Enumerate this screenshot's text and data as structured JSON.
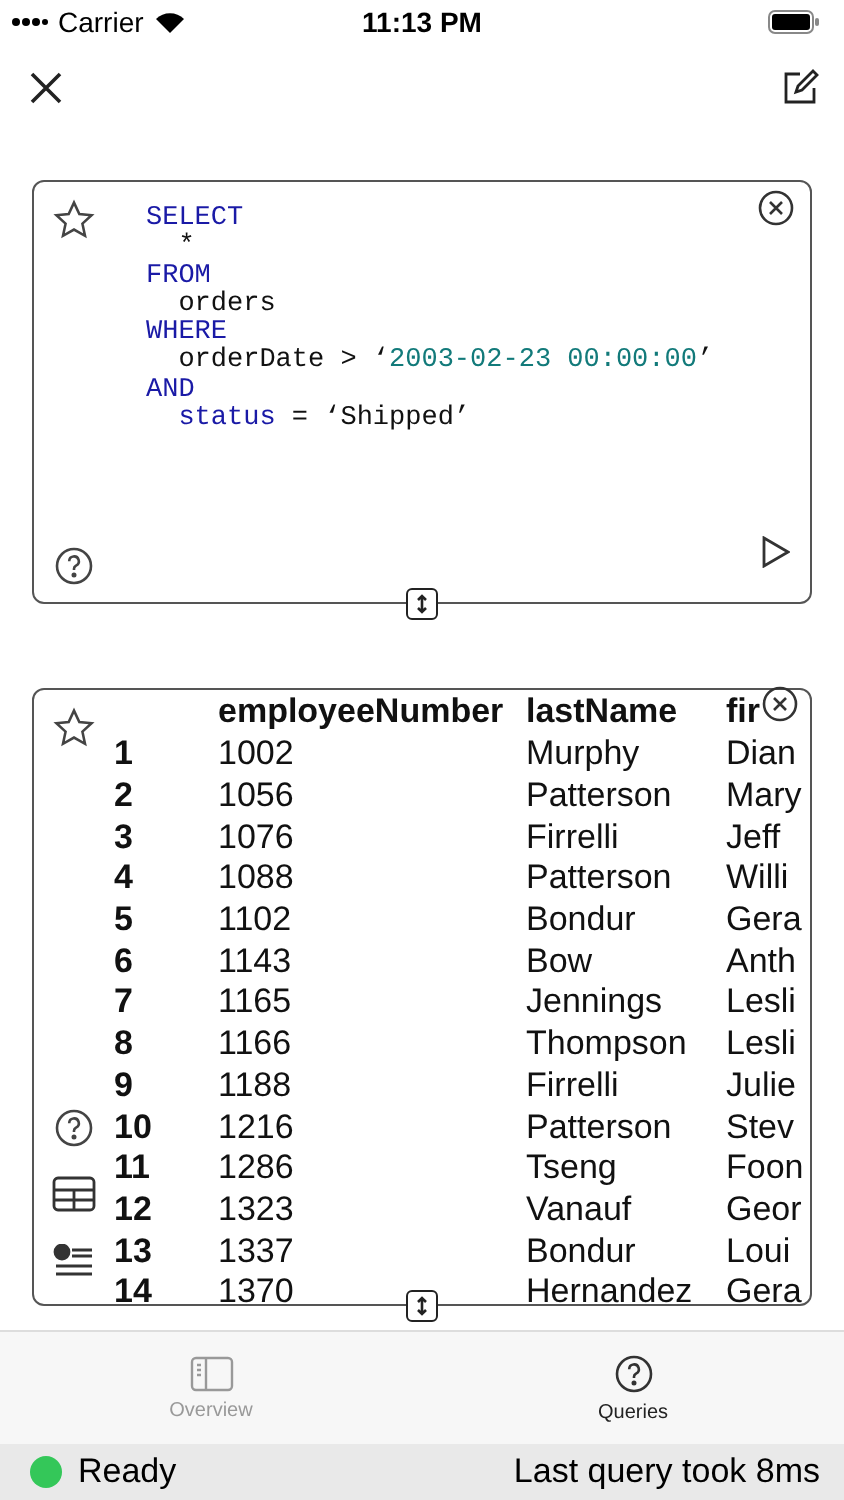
{
  "status_bar": {
    "carrier": "Carrier",
    "time": "11:13 PM"
  },
  "query_card": {
    "lines": [
      [
        {
          "text": "SELECT",
          "kind": "keyword"
        }
      ],
      [
        {
          "text": "  *",
          "kind": "plain"
        }
      ],
      [
        {
          "text": "FROM",
          "kind": "keyword"
        }
      ],
      [
        {
          "text": "  orders",
          "kind": "plain"
        }
      ],
      [
        {
          "text": "WHERE",
          "kind": "keyword"
        }
      ],
      [
        {
          "text": "  orderDate > ‘",
          "kind": "plain"
        },
        {
          "text": "2003-02-23 00:00:00",
          "kind": "literal"
        },
        {
          "text": "’",
          "kind": "plain"
        }
      ],
      [
        {
          "text": "AND",
          "kind": "keyword"
        }
      ],
      [
        {
          "text": "  status",
          "kind": "keyword"
        },
        {
          "text": " = ‘Shipped’",
          "kind": "plain"
        }
      ]
    ]
  },
  "results": {
    "columns": [
      "",
      "employeeNumber",
      "lastName",
      "fir"
    ],
    "rows": [
      [
        "1",
        "1002",
        "Murphy",
        "Dian"
      ],
      [
        "2",
        "1056",
        "Patterson",
        "Mary"
      ],
      [
        "3",
        "1076",
        "Firrelli",
        "Jeff"
      ],
      [
        "4",
        "1088",
        "Patterson",
        "Willi"
      ],
      [
        "5",
        "1102",
        "Bondur",
        "Gera"
      ],
      [
        "6",
        "1143",
        "Bow",
        "Anth"
      ],
      [
        "7",
        "1165",
        "Jennings",
        "Lesli"
      ],
      [
        "8",
        "1166",
        "Thompson",
        "Lesli"
      ],
      [
        "9",
        "1188",
        "Firrelli",
        "Julie"
      ],
      [
        "10",
        "1216",
        "Patterson",
        "Stev"
      ],
      [
        "11",
        "1286",
        "Tseng",
        "Foon"
      ],
      [
        "12",
        "1323",
        "Vanauf",
        "Geor"
      ],
      [
        "13",
        "1337",
        "Bondur",
        "Loui"
      ],
      [
        "14",
        "1370",
        "Hernandez",
        "Gera"
      ]
    ]
  },
  "tabs": [
    {
      "label": "Overview",
      "selected": false,
      "kind": "sidebar"
    },
    {
      "label": "Queries",
      "selected": true,
      "kind": "help"
    }
  ],
  "footer": {
    "status": "Ready",
    "color": "#34c759",
    "message": "Last query took 8ms"
  }
}
